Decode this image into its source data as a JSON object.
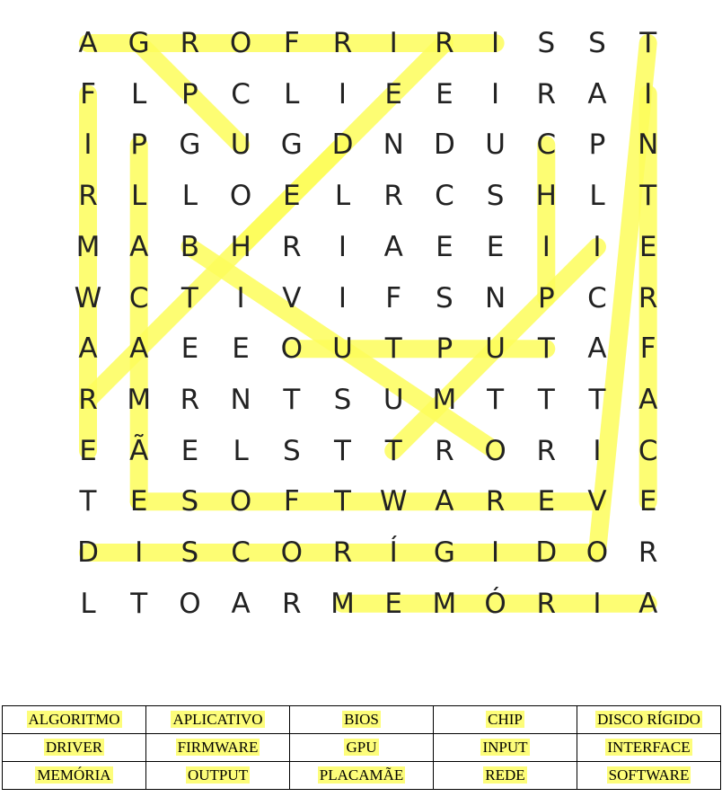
{
  "puzzle": {
    "rows": [
      [
        "A",
        "G",
        "R",
        "O",
        "F",
        "R",
        "I",
        "R",
        "I",
        "S",
        "S",
        "T"
      ],
      [
        "F",
        "L",
        "P",
        "C",
        "L",
        "I",
        "E",
        "E",
        "I",
        "R",
        "A",
        "I"
      ],
      [
        "I",
        "P",
        "G",
        "U",
        "G",
        "D",
        "N",
        "D",
        "U",
        "C",
        "P",
        "N"
      ],
      [
        "R",
        "L",
        "L",
        "O",
        "E",
        "L",
        "R",
        "C",
        "S",
        "H",
        "L",
        "T"
      ],
      [
        "M",
        "A",
        "B",
        "H",
        "R",
        "I",
        "A",
        "E",
        "E",
        "I",
        "I",
        "E"
      ],
      [
        "W",
        "C",
        "T",
        "I",
        "V",
        "I",
        "F",
        "S",
        "N",
        "P",
        "C",
        "R"
      ],
      [
        "A",
        "A",
        "E",
        "E",
        "O",
        "U",
        "T",
        "P",
        "U",
        "T",
        "A",
        "F"
      ],
      [
        "R",
        "M",
        "R",
        "N",
        "T",
        "S",
        "U",
        "M",
        "T",
        "T",
        "T",
        "A"
      ],
      [
        "E",
        "Ã",
        "E",
        "L",
        "S",
        "T",
        "T",
        "R",
        "O",
        "R",
        "I",
        "C"
      ],
      [
        "T",
        "E",
        "S",
        "O",
        "F",
        "T",
        "W",
        "A",
        "R",
        "E",
        "V",
        "E"
      ],
      [
        "D",
        "I",
        "S",
        "C",
        "O",
        "R",
        "Í",
        "G",
        "I",
        "D",
        "O",
        "R"
      ],
      [
        "L",
        "T",
        "O",
        "A",
        "R",
        "M",
        "E",
        "M",
        "Ó",
        "R",
        "I",
        "A"
      ]
    ],
    "found": [
      {
        "word": "ALGORITMO",
        "from": [
          0,
          0
        ],
        "to": [
          0,
          8
        ]
      },
      {
        "word": "APLICATIVO",
        "from": [
          0,
          11
        ],
        "to": [
          10,
          10
        ]
      },
      {
        "word": "BIOS",
        "from": [
          4,
          2
        ],
        "to": [
          8,
          8
        ]
      },
      {
        "word": "CHIP",
        "from": [
          2,
          9
        ],
        "to": [
          5,
          9
        ]
      },
      {
        "word": "DISCO RÍGIDO",
        "from": [
          10,
          0
        ],
        "to": [
          10,
          10
        ]
      },
      {
        "word": "DRIVER",
        "from": [
          2,
          5
        ],
        "to": [
          7,
          0
        ]
      },
      {
        "word": "FIRMWARE",
        "from": [
          1,
          0
        ],
        "to": [
          8,
          0
        ]
      },
      {
        "word": "GPU",
        "from": [
          0,
          1
        ],
        "to": [
          2,
          3
        ]
      },
      {
        "word": "INPUT",
        "from": [
          4,
          10
        ],
        "to": [
          8,
          6
        ]
      },
      {
        "word": "INTERFACE",
        "from": [
          1,
          11
        ],
        "to": [
          9,
          11
        ]
      },
      {
        "word": "MEMÓRIA",
        "from": [
          11,
          5
        ],
        "to": [
          11,
          11
        ]
      },
      {
        "word": "OUTPUT",
        "from": [
          6,
          4
        ],
        "to": [
          6,
          9
        ]
      },
      {
        "word": "PLACAMÃE",
        "from": [
          2,
          1
        ],
        "to": [
          9,
          1
        ]
      },
      {
        "word": "REDE",
        "from": [
          0,
          7
        ],
        "to": [
          4,
          3
        ]
      },
      {
        "word": "SOFTWARE",
        "from": [
          9,
          1
        ],
        "to": [
          9,
          10
        ]
      }
    ],
    "highlight_color": "#fdfd5a"
  },
  "word_list": {
    "rows": [
      [
        "ALGORITMO",
        "APLICATIVO",
        "BIOS",
        "CHIP",
        "DISCO RÍGIDO"
      ],
      [
        "DRIVER",
        "FIRMWARE",
        "GPU",
        "INPUT",
        "INTERFACE"
      ],
      [
        "MEMÓRIA",
        "OUTPUT",
        "PLACAMÃE",
        "REDE",
        "SOFTWARE"
      ]
    ]
  }
}
